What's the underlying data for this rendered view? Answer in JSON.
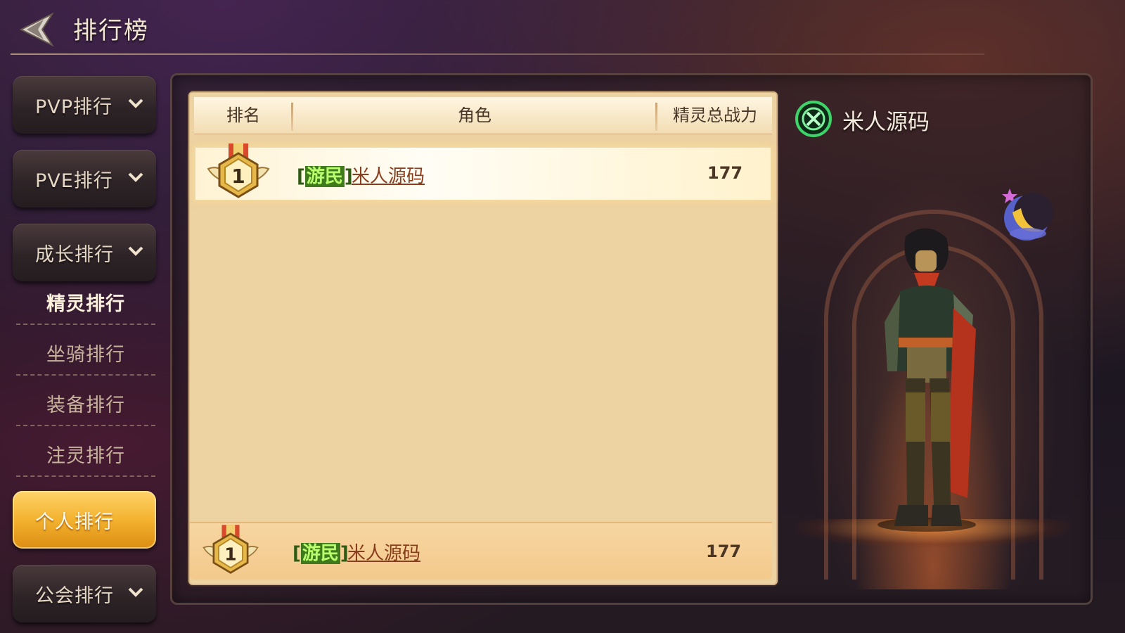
{
  "header": {
    "title": "排行榜"
  },
  "sidebar": {
    "categories": [
      {
        "label": "PVP排行"
      },
      {
        "label": "PVE排行"
      },
      {
        "label": "成长排行"
      },
      {
        "label": "个人排行"
      },
      {
        "label": "公会排行"
      }
    ],
    "sub_items": [
      {
        "label": "精灵排行"
      },
      {
        "label": "坐骑排行"
      },
      {
        "label": "装备排行"
      },
      {
        "label": "注灵排行"
      }
    ]
  },
  "table": {
    "headers": [
      "排名",
      "角色",
      "精灵总战力"
    ],
    "rows": [
      {
        "rank": 1,
        "tag": "游民",
        "name": "米人源码",
        "power": "177"
      }
    ],
    "my_row": {
      "rank": 1,
      "tag": "游民",
      "name": "米人源码",
      "power": "177"
    }
  },
  "preview": {
    "name": "米人源码"
  },
  "colors": {
    "accent": "#f3b22f",
    "tag_green": "#63b62a",
    "name_brown": "#8a3d1d",
    "panel": "#edd2a2"
  },
  "icons": [
    "back-arrow-icon",
    "chevron-down-icon",
    "rank-medal-icon",
    "guild-emblem-icon",
    "moon-pet-icon"
  ]
}
